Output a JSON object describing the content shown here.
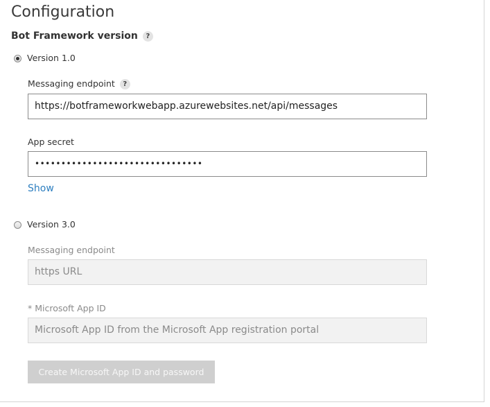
{
  "page": {
    "title": "Configuration"
  },
  "section": {
    "label": "Bot Framework version",
    "help": "?"
  },
  "version1": {
    "label": "Version 1.0",
    "selected": true,
    "endpoint_label": "Messaging endpoint",
    "endpoint_help": "?",
    "endpoint_value": "https://botframeworkwebapp.azurewebsites.net/api/messages",
    "secret_label": "App secret",
    "secret_value": "••••••••••••••••••••••••••••••••",
    "show_link": "Show"
  },
  "version3": {
    "label": "Version 3.0",
    "selected": false,
    "endpoint_label": "Messaging endpoint",
    "endpoint_placeholder": "https URL",
    "appid_label": "* Microsoft App ID",
    "appid_placeholder": "Microsoft App ID from the Microsoft App registration portal",
    "create_button": "Create Microsoft App ID and password"
  },
  "colors": {
    "link": "#2e7fc0",
    "disabled_bg": "#f2f2f2",
    "button_disabled": "#cfcfcf"
  }
}
